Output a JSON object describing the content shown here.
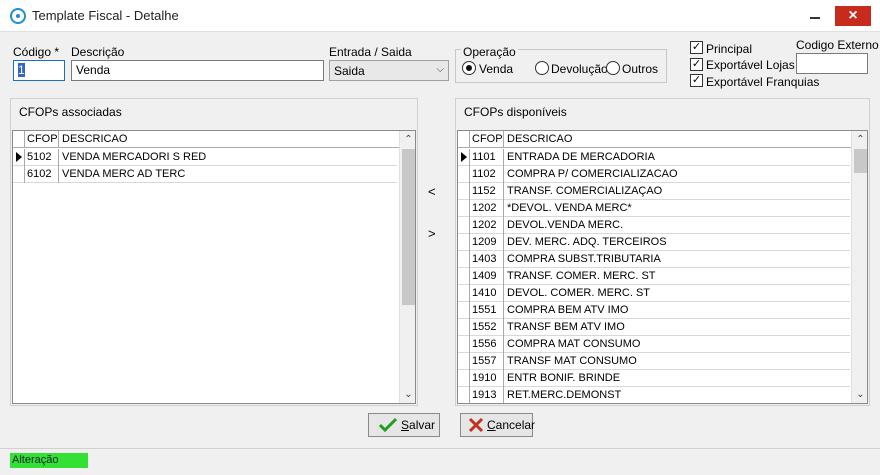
{
  "window": {
    "title": "Template Fiscal - Detalhe",
    "close_glyph": "×"
  },
  "form": {
    "codigo_label": "Código *",
    "codigo_value": "1",
    "descricao_label": "Descrição",
    "descricao_value": "Venda",
    "entrada_saida_label": "Entrada / Saida",
    "entrada_saida_value": "Saida",
    "operacao_label": "Operação",
    "operacao_options": [
      "Venda",
      "Devolução",
      "Outros"
    ],
    "operacao_selected": "Venda",
    "checkboxes": [
      {
        "label": "Principal",
        "checked": true
      },
      {
        "label": "Exportável Lojas",
        "checked": true
      },
      {
        "label": "Exportável Franquias",
        "checked": true
      }
    ],
    "codigo_externo_label": "Codigo Externo",
    "codigo_externo_value": ""
  },
  "associadas": {
    "title": "CFOPs associadas",
    "columns": [
      "CFOP",
      "DESCRICAO"
    ],
    "rows": [
      {
        "cfop": "5102",
        "descricao": "VENDA MERCADORI S RED"
      },
      {
        "cfop": "6102",
        "descricao": "VENDA MERC AD TERC"
      }
    ]
  },
  "transfer": {
    "add_label": "<",
    "remove_label": ">"
  },
  "disponiveis": {
    "title": "CFOPs disponíveis",
    "columns": [
      "CFOP",
      "DESCRICAO"
    ],
    "rows": [
      {
        "cfop": "1101",
        "descricao": "ENTRADA DE MERCADORIA"
      },
      {
        "cfop": "1102",
        "descricao": "COMPRA P/ COMERCIALIZACAO"
      },
      {
        "cfop": "1152",
        "descricao": "TRANSF. COMERCIALIZAÇAO"
      },
      {
        "cfop": "1202",
        "descricao": "*DEVOL. VENDA MERC*"
      },
      {
        "cfop": "1202",
        "descricao": "DEVOL.VENDA MERC."
      },
      {
        "cfop": "1209",
        "descricao": "DEV. MERC. ADQ. TERCEIROS"
      },
      {
        "cfop": "1403",
        "descricao": "COMPRA SUBST.TRIBUTARIA"
      },
      {
        "cfop": "1409",
        "descricao": "TRANSF. COMER.  MERC. ST"
      },
      {
        "cfop": "1410",
        "descricao": "DEVOL. COMER.  MERC. ST"
      },
      {
        "cfop": "1551",
        "descricao": "COMPRA BEM ATV IMO"
      },
      {
        "cfop": "1552",
        "descricao": "TRANSF BEM ATV IMO"
      },
      {
        "cfop": "1556",
        "descricao": "COMPRA MAT CONSUMO"
      },
      {
        "cfop": "1557",
        "descricao": "TRANSF MAT CONSUMO"
      },
      {
        "cfop": "1910",
        "descricao": "ENTR BONIF. BRINDE"
      },
      {
        "cfop": "1913",
        "descricao": "RET.MERC.DEMONST"
      }
    ]
  },
  "buttons": {
    "salvar": "Salvar",
    "cancelar": "Cancelar"
  },
  "status": {
    "mode": "Alteração",
    "mode_color": "#33e033"
  }
}
